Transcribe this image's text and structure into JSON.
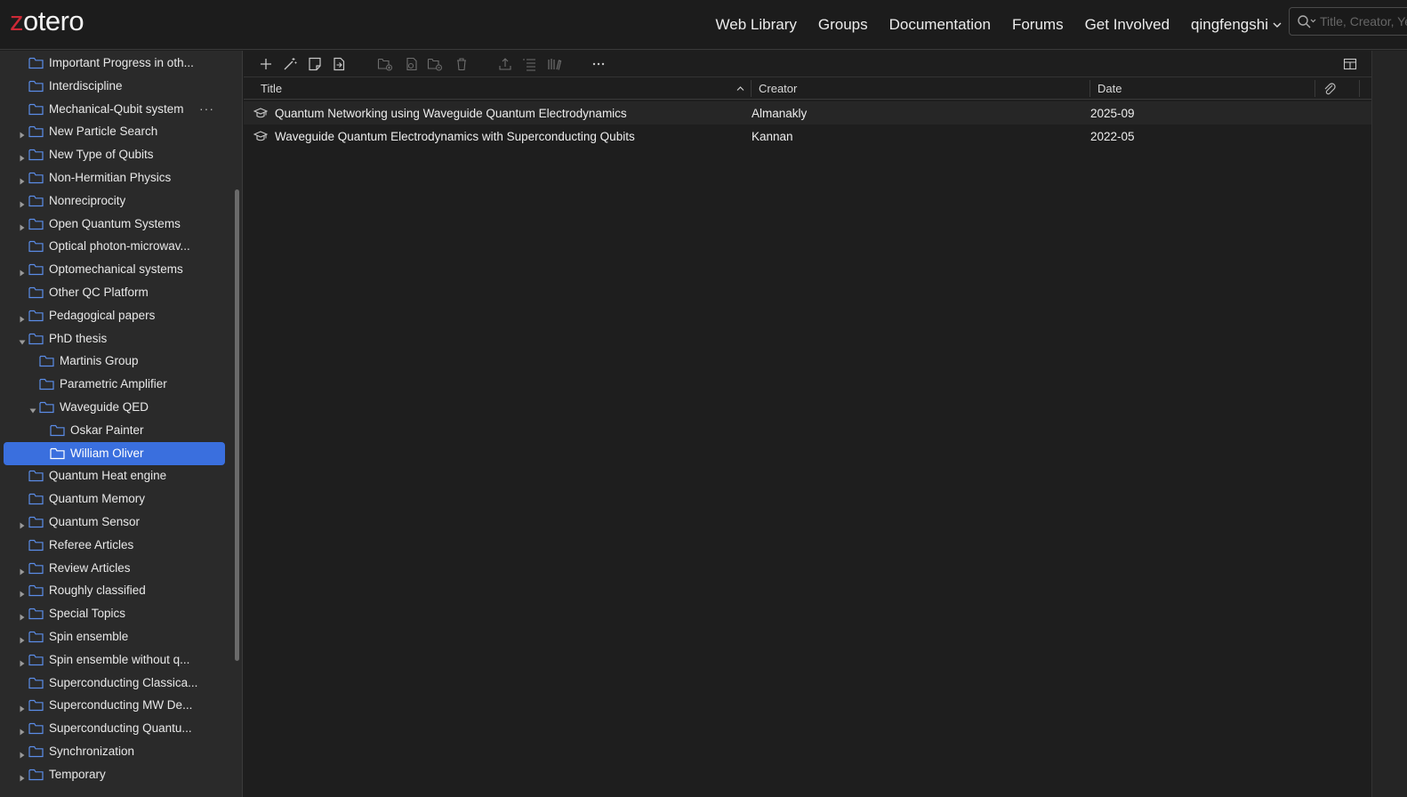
{
  "header": {
    "logo_z": "z",
    "logo_rest": "otero",
    "nav": [
      "Web Library",
      "Groups",
      "Documentation",
      "Forums",
      "Get Involved"
    ],
    "user": "qingfengshi",
    "search_placeholder": "Title, Creator, Year"
  },
  "sidebar": {
    "items": [
      {
        "label": "Important Progress in oth...",
        "twisty": "none",
        "depth": 0
      },
      {
        "label": "Interdiscipline",
        "twisty": "none",
        "depth": 0
      },
      {
        "label": "Mechanical-Qubit system",
        "twisty": "none",
        "depth": 0,
        "more": "···"
      },
      {
        "label": "New Particle Search",
        "twisty": "collapsed",
        "depth": 0
      },
      {
        "label": "New Type of Qubits",
        "twisty": "collapsed",
        "depth": 0
      },
      {
        "label": "Non-Hermitian Physics",
        "twisty": "collapsed",
        "depth": 0
      },
      {
        "label": "Nonreciprocity",
        "twisty": "collapsed",
        "depth": 0
      },
      {
        "label": "Open Quantum Systems",
        "twisty": "collapsed",
        "depth": 0
      },
      {
        "label": "Optical photon-microwav...",
        "twisty": "none",
        "depth": 0
      },
      {
        "label": "Optomechanical systems",
        "twisty": "collapsed",
        "depth": 0
      },
      {
        "label": "Other QC Platform",
        "twisty": "none",
        "depth": 0
      },
      {
        "label": "Pedagogical papers",
        "twisty": "collapsed",
        "depth": 0
      },
      {
        "label": "PhD thesis",
        "twisty": "expanded",
        "depth": 0
      },
      {
        "label": "Martinis Group",
        "twisty": "none",
        "depth": 1
      },
      {
        "label": "Parametric Amplifier",
        "twisty": "none",
        "depth": 1
      },
      {
        "label": "Waveguide QED",
        "twisty": "expanded",
        "depth": 1
      },
      {
        "label": "Oskar Painter",
        "twisty": "none",
        "depth": 2
      },
      {
        "label": "William Oliver",
        "twisty": "none",
        "depth": 2,
        "selected": true
      },
      {
        "label": "Quantum Heat engine",
        "twisty": "none",
        "depth": 0
      },
      {
        "label": "Quantum Memory",
        "twisty": "none",
        "depth": 0
      },
      {
        "label": "Quantum Sensor",
        "twisty": "collapsed",
        "depth": 0
      },
      {
        "label": "Referee Articles",
        "twisty": "none",
        "depth": 0
      },
      {
        "label": "Review Articles",
        "twisty": "collapsed",
        "depth": 0
      },
      {
        "label": "Roughly classified",
        "twisty": "collapsed",
        "depth": 0
      },
      {
        "label": "Special Topics",
        "twisty": "collapsed",
        "depth": 0
      },
      {
        "label": "Spin ensemble",
        "twisty": "collapsed",
        "depth": 0
      },
      {
        "label": "Spin ensemble without q...",
        "twisty": "collapsed",
        "depth": 0
      },
      {
        "label": "Superconducting Classica...",
        "twisty": "none",
        "depth": 0
      },
      {
        "label": "Superconducting MW De...",
        "twisty": "collapsed",
        "depth": 0
      },
      {
        "label": "Superconducting Quantu...",
        "twisty": "collapsed",
        "depth": 0
      },
      {
        "label": "Synchronization",
        "twisty": "collapsed",
        "depth": 0
      },
      {
        "label": "Temporary",
        "twisty": "collapsed",
        "depth": 0
      }
    ]
  },
  "toolbar": {
    "icons": [
      "new-item-icon",
      "magic-wand-icon",
      "new-note-icon",
      "import-icon",
      "new-collection-icon",
      "duplicate-icon",
      "remove-from-collection-icon",
      "trash-icon",
      "export-icon",
      "create-bibliography-icon",
      "library-lookup-icon",
      "more-options-icon"
    ],
    "column_picker_icon": "column-picker-icon"
  },
  "columns": {
    "title": "Title",
    "creator": "Creator",
    "date": "Date",
    "attachment_icon": "paperclip-icon",
    "sort": "title-ascending"
  },
  "items": [
    {
      "type_icon": "thesis-icon",
      "title": "Quantum Networking using Waveguide Quantum Electrodynamics",
      "creator": "Almanakly",
      "date": "2025-09"
    },
    {
      "type_icon": "thesis-icon",
      "title": "Waveguide Quantum Electrodynamics with Superconducting Qubits",
      "creator": "Kannan",
      "date": "2022-05"
    }
  ],
  "colors": {
    "accent": "#3a6fde",
    "brand_red": "#cc2936"
  }
}
